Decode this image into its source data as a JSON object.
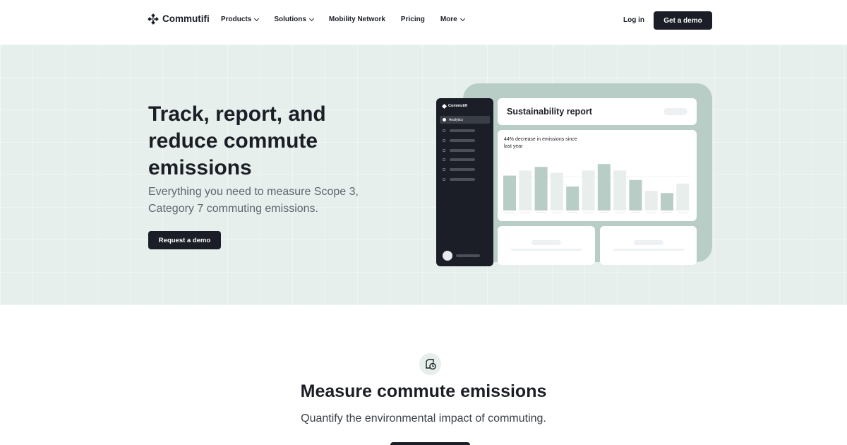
{
  "nav": {
    "logo_text": "Commutifi",
    "links": [
      {
        "label": "Products",
        "has_dropdown": true
      },
      {
        "label": "Solutions",
        "has_dropdown": true
      },
      {
        "label": "Mobility Network",
        "has_dropdown": false
      },
      {
        "label": "Pricing",
        "has_dropdown": false
      },
      {
        "label": "More",
        "has_dropdown": true
      }
    ],
    "login_label": "Log in",
    "cta_label": "Get a demo"
  },
  "hero": {
    "title": "Track, report, and reduce commute emissions",
    "subtitle": "Everything you need to measure Scope 3, Category 7 commuting emissions.",
    "cta_label": "Request a demo"
  },
  "dashboard": {
    "sidebar_logo": "Commutifi",
    "sidebar_active_item": "Analytics",
    "report_title": "Sustainability report",
    "chart_label": "44% decrease in emissions since last year",
    "chart_data": {
      "type": "bar",
      "values": [
        48,
        55,
        60,
        52,
        33,
        55,
        64,
        55,
        42,
        27,
        24,
        37
      ],
      "highlight": [
        true,
        false,
        true,
        false,
        true,
        false,
        true,
        false,
        true,
        false,
        true,
        false
      ],
      "ylim": [
        0,
        70
      ],
      "colors": {
        "highlight": "#b8cdc5",
        "muted": "#e7eeeb"
      }
    }
  },
  "feature": {
    "icon": "leaf-clock-icon",
    "title": "Measure commute emissions",
    "subtitle": "Quantify the environmental impact of commuting."
  },
  "colors": {
    "dark": "#1b1e26",
    "hero_bg": "#e6efeb",
    "accent": "#b8cdc5"
  }
}
